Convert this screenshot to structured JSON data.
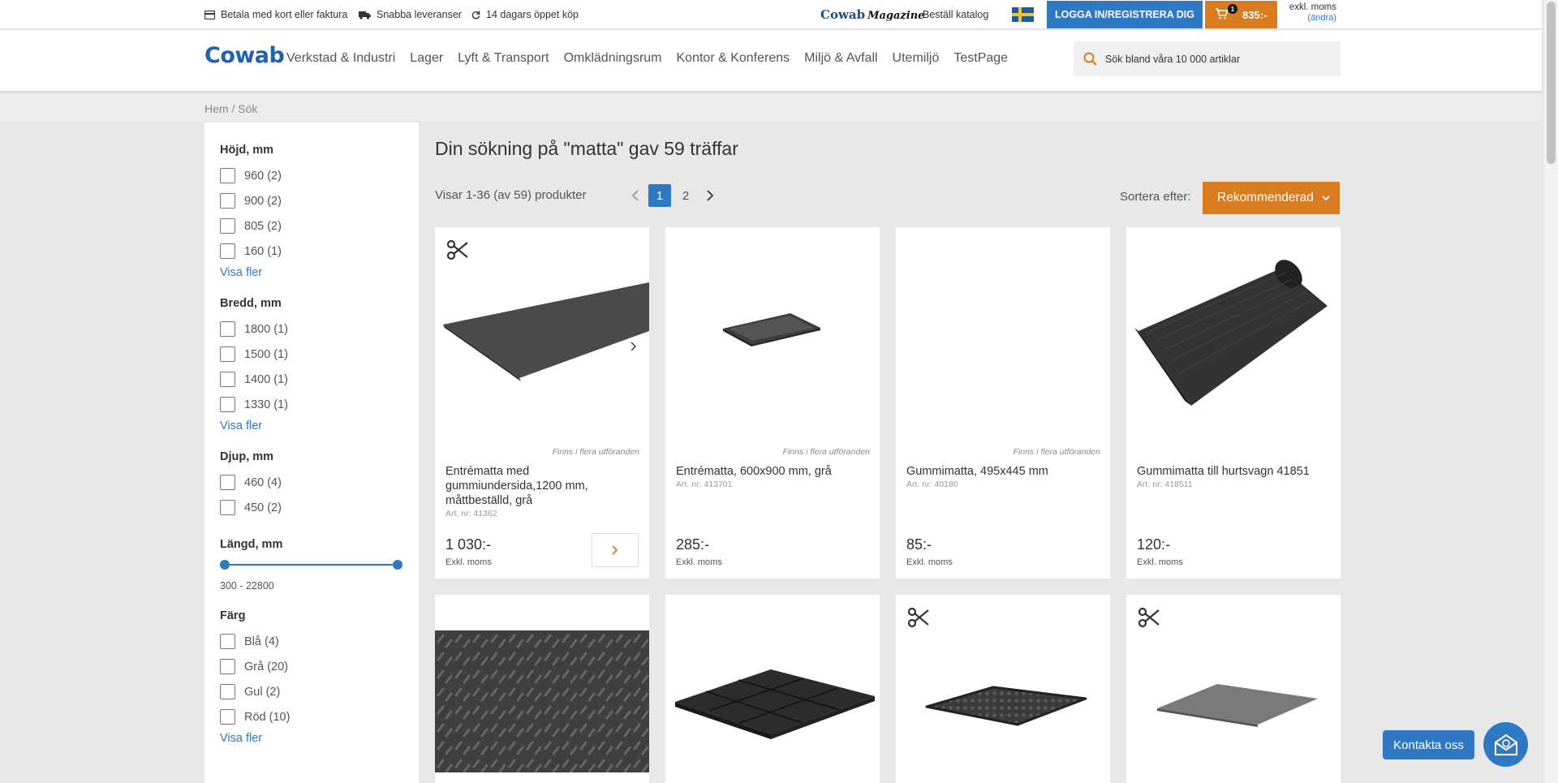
{
  "topbar": {
    "usps": [
      {
        "icon": "card-icon",
        "text": "Betala med kort eller faktura"
      },
      {
        "icon": "truck-icon",
        "text": "Snabba leveranser"
      },
      {
        "icon": "refresh-icon",
        "text": "14 dagars öppet köp"
      }
    ],
    "magazine_brand": "Cowab",
    "magazine_word": "Magazine",
    "catalog_link": "Beställ katalog",
    "flag": "swedish-flag-icon",
    "login_label": "LOGGA IN/REGISTRERA DIG",
    "cart_count": "1",
    "cart_total": "835:-",
    "vat_label": "exkl. moms",
    "vat_change": "(ändra)"
  },
  "header": {
    "logo": "Cowab",
    "nav": [
      "Verkstad & Industri",
      "Lager",
      "Lyft & Transport",
      "Omklädningsrum",
      "Kontor & Konferens",
      "Miljö & Avfall",
      "Utemiljö",
      "TestPage"
    ],
    "search_placeholder": "Sök bland våra 10 000 artiklar"
  },
  "breadcrumb": "Hem / Sök",
  "filters": {
    "hojd": {
      "title": "Höjd, mm",
      "options": [
        "960 (2)",
        "900 (2)",
        "805 (2)",
        "160 (1)"
      ],
      "more": "Visa fler"
    },
    "bredd": {
      "title": "Bredd, mm",
      "options": [
        "1800 (1)",
        "1500 (1)",
        "1400 (1)",
        "1330 (1)"
      ],
      "more": "Visa fler"
    },
    "djup": {
      "title": "Djup, mm",
      "options": [
        "460 (4)",
        "450 (2)"
      ]
    },
    "langd": {
      "title": "Längd, mm",
      "range": "300 - 22800"
    },
    "farg": {
      "title": "Färg",
      "options": [
        "Blå (4)",
        "Grå (20)",
        "Gul (2)",
        "Röd (10)"
      ],
      "more": "Visa fler"
    }
  },
  "results": {
    "title": "Din sökning på \"matta\" gav 59 träffar",
    "showing": "Visar 1-36 (av 59) produkter",
    "pages": [
      "1",
      "2"
    ],
    "sort_label": "Sortera efter:",
    "sort_value": "Rekommenderad"
  },
  "products": [
    {
      "name": "Entrématta med gummiundersida,1200 mm, måttbeställd, grå",
      "artnr": "Art. nr: 41362",
      "price": "1 030:-",
      "exkl": "Exkl. moms",
      "variants": "Finns i flera utföranden"
    },
    {
      "name": "Entrématta, 600x900 mm, grå",
      "artnr": "Art. nr: 413701",
      "price": "285:-",
      "exkl": "Exkl. moms",
      "variants": "Finns i flera utföranden"
    },
    {
      "name": "Gummimatta, 495x445 mm",
      "artnr": "Art. nr: 40180",
      "price": "85:-",
      "exkl": "Exkl. moms",
      "variants": "Finns i flera utföranden"
    },
    {
      "name": "Gummimatta till hurtsvagn 41851",
      "artnr": "Art. nr: 418511",
      "price": "120:-",
      "exkl": "Exkl. moms"
    }
  ],
  "contact_label": "Kontakta oss"
}
